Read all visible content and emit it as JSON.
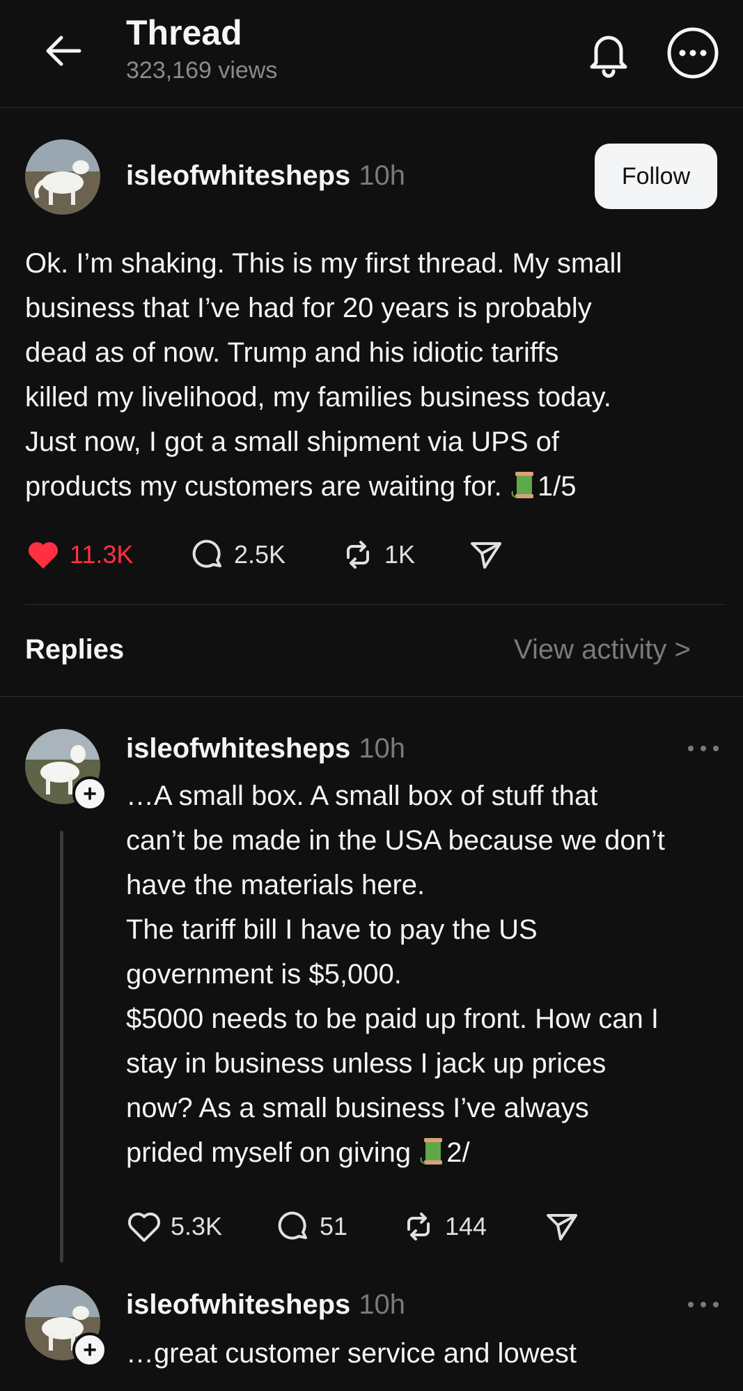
{
  "header": {
    "title": "Thread",
    "views": "323,169 views",
    "back_icon": "arrow-left-icon",
    "notify_icon": "bell-icon",
    "more_icon": "more-circle-icon"
  },
  "main_post": {
    "username": "isleofwhitesheps",
    "time": "10h",
    "follow_label": "Follow",
    "text_lines": [
      "Ok. I’m shaking. This is my first thread. My small",
      "business that I’ve had for 20 years is probably",
      "dead as of now. Trump and his idiotic tariffs",
      "killed my livelihood, my families business today.",
      "Just now,  I got a small shipment via UPS of",
      "products my customers are waiting for. "
    ],
    "suffix": "1/5",
    "likes": "11.3K",
    "comments": "2.5K",
    "reposts": "1K",
    "liked": true
  },
  "replies_bar": {
    "label": "Replies",
    "view_activity": "View activity >"
  },
  "reply1": {
    "username": "isleofwhitesheps",
    "time": "10h",
    "text_lines": [
      "…A small box. A small box of stuff that",
      "can’t be made in the USA because we don’t",
      "have the materials here.",
      "The tariff bill I have to pay the US",
      "government is $5,000.",
      "$5000 needs to be paid up front. How can I",
      "stay in business unless I jack up prices",
      "now? As a small business I’ve always",
      "prided myself on giving "
    ],
    "suffix": "2/",
    "likes": "5.3K",
    "comments": "51",
    "reposts": "144"
  },
  "reply2": {
    "username": "isleofwhitesheps",
    "time": "10h",
    "text_lines": [
      "…great customer service and lowest"
    ]
  },
  "colors": {
    "background": "#101010",
    "text": "#f3f5f7",
    "muted": "#7a7a7a",
    "like_red": "#ff3040",
    "divider": "#2e2e2e"
  }
}
